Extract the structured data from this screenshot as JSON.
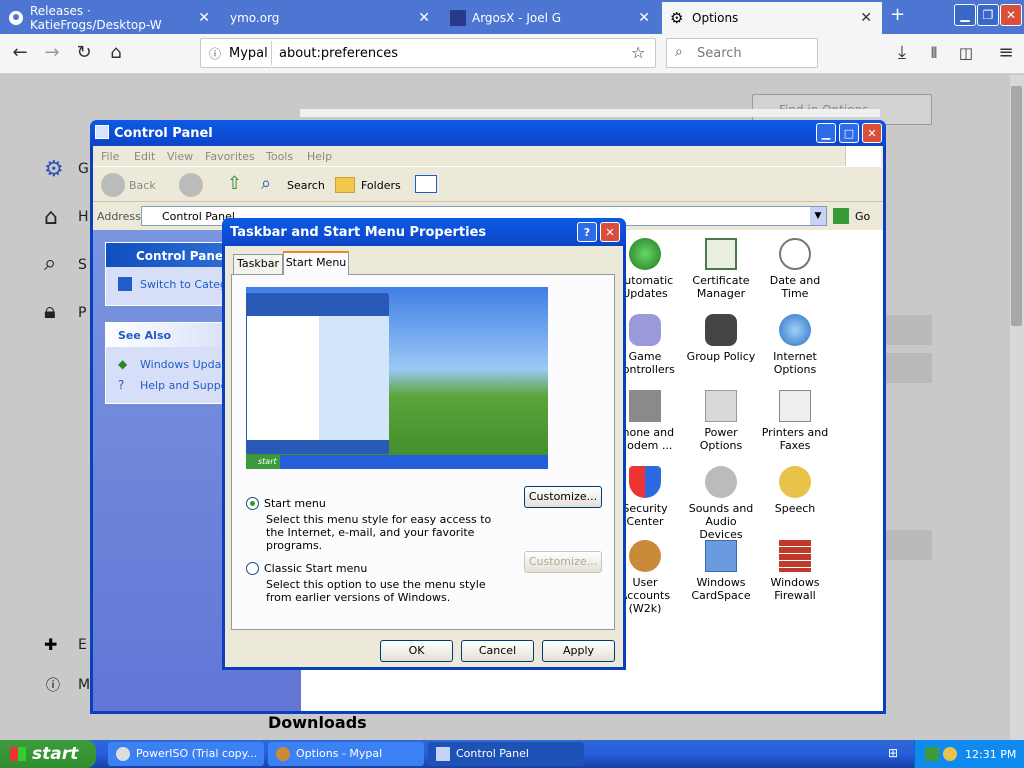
{
  "browser": {
    "tabs": [
      {
        "label": "Releases · KatieFrogs/Desktop-W"
      },
      {
        "label": "ymo.org"
      },
      {
        "label": "ArgosX - Joel G"
      },
      {
        "label": "Options"
      }
    ],
    "identity_label": "Mypal",
    "url": "about:preferences",
    "search_placeholder": "Search"
  },
  "prefs": {
    "find_placeholder": "Find in Options",
    "nav_initials": [
      "G",
      "H",
      "S",
      "P"
    ],
    "bottom_initials": [
      "E",
      "M"
    ],
    "downloads_heading": "Downloads"
  },
  "control_panel": {
    "title": "Control Panel",
    "menu": [
      "File",
      "Edit",
      "View",
      "Favorites",
      "Tools",
      "Help"
    ],
    "toolbar": {
      "back": "Back",
      "search": "Search",
      "folders": "Folders"
    },
    "address_label": "Address",
    "address_value": "Control Panel",
    "go_label": "Go",
    "sidebar": {
      "panel_title": "Control Panel",
      "switch_link": "Switch to Category View",
      "see_also_title": "See Also",
      "see_also_links": [
        "Windows Update",
        "Help and Support"
      ]
    },
    "items": [
      {
        "label": "Automatic Updates"
      },
      {
        "label": "Certificate Manager"
      },
      {
        "label": "Date and Time"
      },
      {
        "label": "Game Controllers"
      },
      {
        "label": "Group Policy"
      },
      {
        "label": "Internet Options"
      },
      {
        "label": "Phone and Modem ..."
      },
      {
        "label": "Power Options"
      },
      {
        "label": "Printers and Faxes"
      },
      {
        "label": "Security Center"
      },
      {
        "label": "Sounds and Audio Devices"
      },
      {
        "label": "Speech"
      },
      {
        "label": "User Accounts (W2k)"
      },
      {
        "label": "Windows CardSpace"
      },
      {
        "label": "Windows Firewall"
      }
    ]
  },
  "dialog": {
    "title": "Taskbar and Start Menu Properties",
    "tabs": [
      "Taskbar",
      "Start Menu"
    ],
    "preview_start": "start",
    "options": [
      {
        "label": "Start menu",
        "description": "Select this menu style for easy access to the Internet, e-mail, and your favorite programs.",
        "customize": "Customize..."
      },
      {
        "label": "Classic Start menu",
        "description": "Select this option to use the menu style from earlier versions of Windows.",
        "customize": "Customize..."
      }
    ],
    "buttons": {
      "ok": "OK",
      "cancel": "Cancel",
      "apply": "Apply"
    }
  },
  "taskbar": {
    "start_label": "start",
    "buttons": [
      {
        "label": "PowerISO (Trial copy..."
      },
      {
        "label": "Options - Mypal"
      },
      {
        "label": "Control Panel"
      }
    ],
    "clock": "12:31 PM"
  },
  "colors": {
    "xp_blue": "#0a3fbf",
    "start_green": "#3c9b3c",
    "taskbar_blue": "#245edb"
  }
}
